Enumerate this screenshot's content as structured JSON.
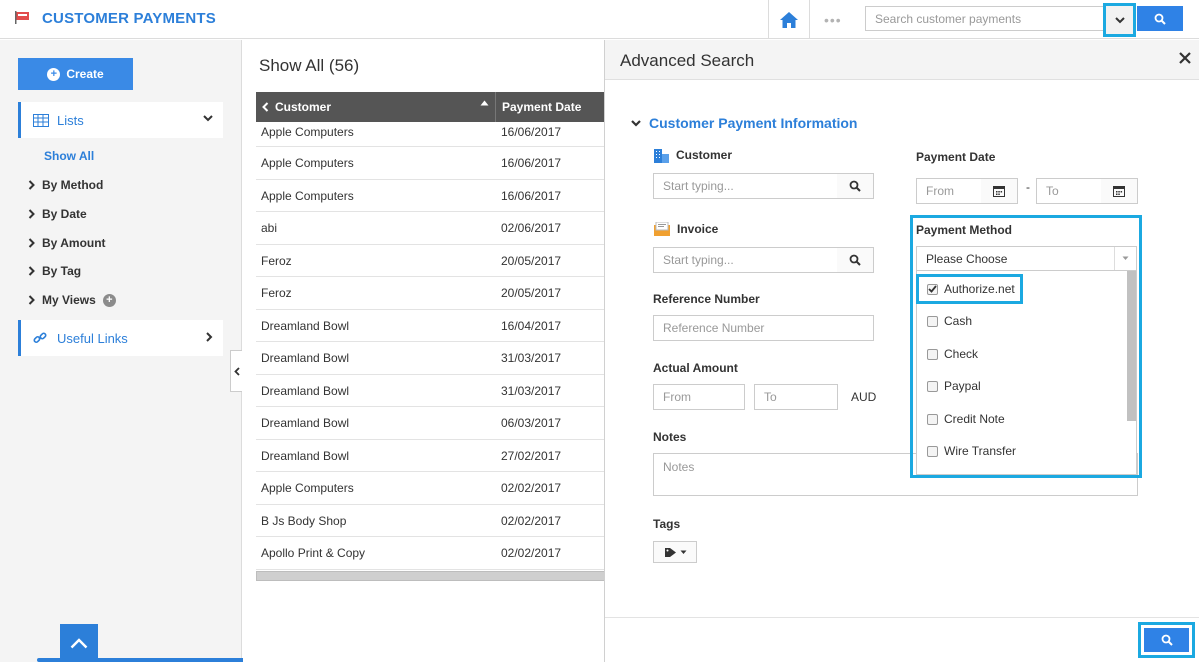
{
  "app": {
    "title": "CUSTOMER PAYMENTS",
    "logo_icon": "payment-flag-icon"
  },
  "topbar": {
    "dots": "•••",
    "search_placeholder": "Search customer payments"
  },
  "sidebar": {
    "create_label": "Create",
    "lists_label": "Lists",
    "nav": {
      "show_all": "Show All",
      "by_method": "By Method",
      "by_date": "By Date",
      "by_amount": "By Amount",
      "by_tag": "By Tag",
      "my_views": "My Views"
    },
    "useful_links": "Useful Links"
  },
  "list": {
    "title": "Show All (56)",
    "columns": {
      "customer": "Customer",
      "payment_date": "Payment Date"
    },
    "rows": [
      {
        "customer": "Apple Computers",
        "date": "16/06/2017"
      },
      {
        "customer": "Apple Computers",
        "date": "16/06/2017"
      },
      {
        "customer": "Apple Computers",
        "date": "16/06/2017"
      },
      {
        "customer": "abi",
        "date": "02/06/2017"
      },
      {
        "customer": "Feroz",
        "date": "20/05/2017"
      },
      {
        "customer": "Feroz",
        "date": "20/05/2017"
      },
      {
        "customer": "Dreamland Bowl",
        "date": "16/04/2017"
      },
      {
        "customer": "Dreamland Bowl",
        "date": "31/03/2017"
      },
      {
        "customer": "Dreamland Bowl",
        "date": "31/03/2017"
      },
      {
        "customer": "Dreamland Bowl",
        "date": "06/03/2017"
      },
      {
        "customer": "Dreamland Bowl",
        "date": "27/02/2017"
      },
      {
        "customer": "Apple Computers",
        "date": "02/02/2017"
      },
      {
        "customer": "B Js Body Shop",
        "date": "02/02/2017"
      },
      {
        "customer": "Apollo Print & Copy",
        "date": "02/02/2017"
      }
    ]
  },
  "advanced_search": {
    "title": "Advanced Search",
    "section_title": "Customer Payment Information",
    "customer": {
      "label": "Customer",
      "placeholder": "Start typing..."
    },
    "invoice": {
      "label": "Invoice",
      "placeholder": "Start typing..."
    },
    "reference_number": {
      "label": "Reference Number",
      "placeholder": "Reference Number"
    },
    "actual_amount": {
      "label": "Actual Amount",
      "from_placeholder": "From",
      "to_placeholder": "To",
      "currency": "AUD"
    },
    "notes": {
      "label": "Notes",
      "placeholder": "Notes"
    },
    "tags": {
      "label": "Tags"
    },
    "payment_date": {
      "label": "Payment Date",
      "from_placeholder": "From",
      "to_placeholder": "To",
      "separator": "-"
    },
    "payment_method": {
      "label": "Payment Method",
      "selected": "Please Choose",
      "options": [
        {
          "label": "Authorize.net",
          "checked": true
        },
        {
          "label": "Cash",
          "checked": false
        },
        {
          "label": "Check",
          "checked": false
        },
        {
          "label": "Paypal",
          "checked": false
        },
        {
          "label": "Credit Note",
          "checked": false
        },
        {
          "label": "Wire Transfer",
          "checked": false
        }
      ]
    }
  },
  "colors": {
    "brand_blue": "#2c7fd9",
    "highlight": "#1ba9e1",
    "header_dark": "#555555"
  }
}
